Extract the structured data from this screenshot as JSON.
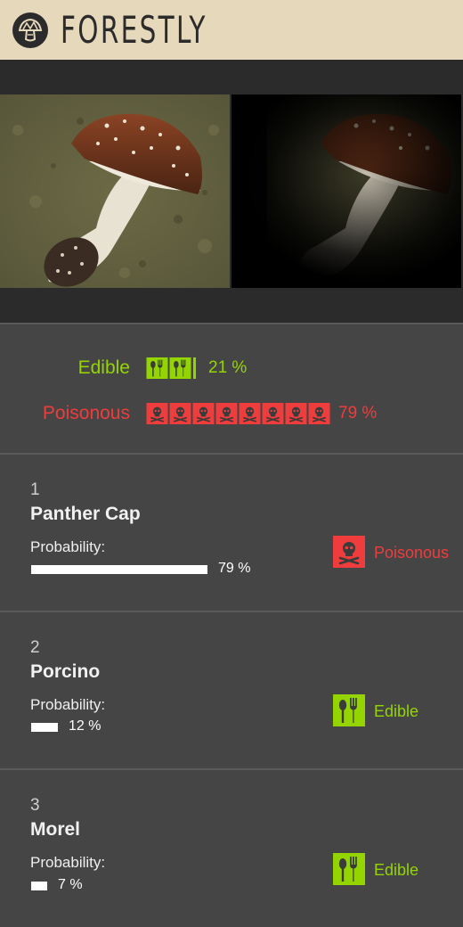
{
  "app": {
    "title": "FORESTLY",
    "logo_icon": "mushroom-logo-icon"
  },
  "colors": {
    "edible": "#94d500",
    "poisonous": "#ef3c3c",
    "header_bg": "#e6d8bb"
  },
  "summary": {
    "edible": {
      "label": "Edible",
      "percent": 21,
      "percent_text": "21 %",
      "icon": "cutlery-icon",
      "icon_count": 2
    },
    "poisonous": {
      "label": "Poisonous",
      "percent": 79,
      "percent_text": "79 %",
      "icon": "skull-crossbones-icon",
      "icon_count": 8
    }
  },
  "results": [
    {
      "rank": "1",
      "name": "Panther Cap",
      "probability_label": "Probability:",
      "probability": 79,
      "probability_text": "79 %",
      "class_label": "Poisonous",
      "class_icon": "skull-crossbones-icon"
    },
    {
      "rank": "2",
      "name": "Porcino",
      "probability_label": "Probability:",
      "probability": 12,
      "probability_text": "12 %",
      "class_label": "Edible",
      "class_icon": "cutlery-icon"
    },
    {
      "rank": "3",
      "name": "Morel",
      "probability_label": "Probability:",
      "probability": 7,
      "probability_text": "7 %",
      "class_label": "Edible",
      "class_icon": "cutlery-icon"
    }
  ]
}
